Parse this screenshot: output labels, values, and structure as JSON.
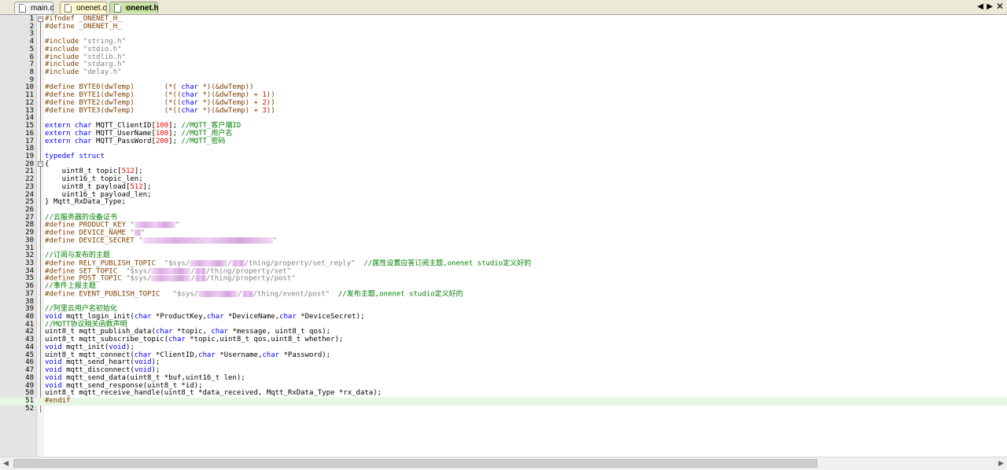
{
  "tabs": [
    {
      "label": "main.c",
      "active": false
    },
    {
      "label": "onenet.c",
      "active": false
    },
    {
      "label": "onenet.h",
      "active": true
    }
  ],
  "icons": {
    "close": "close-icon",
    "tab_left": "scroll-left-icon",
    "tab_right": "scroll-right-icon",
    "file": "file-icon",
    "fold": "fold-marker-icon"
  },
  "colors": {
    "preprocessor": "#804000",
    "string": "#808080",
    "keyword": "#0000ff",
    "number": "#ff0000",
    "comment": "#008000",
    "current_line": "#e8f6e6"
  },
  "editor": {
    "current_line": 51,
    "lines": [
      [
        {
          "t": "#ifndef _ONENET_H_",
          "c": "pp"
        }
      ],
      [
        {
          "t": "#define _ONENET_H_",
          "c": "pp"
        }
      ],
      [],
      [
        {
          "t": "#include ",
          "c": "pp"
        },
        {
          "t": "\"string.h\"",
          "c": "str"
        }
      ],
      [
        {
          "t": "#include ",
          "c": "pp"
        },
        {
          "t": "\"stdio.h\"",
          "c": "str"
        }
      ],
      [
        {
          "t": "#include ",
          "c": "pp"
        },
        {
          "t": "\"stdlib.h\"",
          "c": "str"
        }
      ],
      [
        {
          "t": "#include ",
          "c": "pp"
        },
        {
          "t": "\"stdarg.h\"",
          "c": "str"
        }
      ],
      [
        {
          "t": "#include ",
          "c": "pp"
        },
        {
          "t": "\"delay.h\"",
          "c": "str"
        }
      ],
      [],
      [
        {
          "t": "#define BYTE0(dwTemp)       (*( ",
          "c": "pp"
        },
        {
          "t": "char",
          "c": "kw"
        },
        {
          "t": " *)(&dwTemp))",
          "c": "pp"
        }
      ],
      [
        {
          "t": "#define BYTE1(dwTemp)       (*((",
          "c": "pp"
        },
        {
          "t": "char",
          "c": "kw"
        },
        {
          "t": " *)(&dwTemp) + ",
          "c": "pp"
        },
        {
          "t": "1",
          "c": "num"
        },
        {
          "t": "))",
          "c": "pp"
        }
      ],
      [
        {
          "t": "#define BYTE2(dwTemp)       (*((",
          "c": "pp"
        },
        {
          "t": "char",
          "c": "kw"
        },
        {
          "t": " *)(&dwTemp) + ",
          "c": "pp"
        },
        {
          "t": "2",
          "c": "num"
        },
        {
          "t": "))",
          "c": "pp"
        }
      ],
      [
        {
          "t": "#define BYTE3(dwTemp)       (*((",
          "c": "pp"
        },
        {
          "t": "char",
          "c": "kw"
        },
        {
          "t": " *)(&dwTemp) + ",
          "c": "pp"
        },
        {
          "t": "3",
          "c": "num"
        },
        {
          "t": "))",
          "c": "pp"
        }
      ],
      [],
      [
        {
          "t": "extern char",
          "c": "kw"
        },
        {
          "t": " MQTT_ClientID[",
          "c": ""
        },
        {
          "t": "100",
          "c": "num"
        },
        {
          "t": "]; ",
          "c": ""
        },
        {
          "t": "//MQTT_客户端ID",
          "c": "cm"
        }
      ],
      [
        {
          "t": "extern char",
          "c": "kw"
        },
        {
          "t": " MQTT_UserName[",
          "c": ""
        },
        {
          "t": "100",
          "c": "num"
        },
        {
          "t": "]; ",
          "c": ""
        },
        {
          "t": "//MQTT_用户名",
          "c": "cm"
        }
      ],
      [
        {
          "t": "extern char",
          "c": "kw"
        },
        {
          "t": " MQTT_PassWord[",
          "c": ""
        },
        {
          "t": "200",
          "c": "num"
        },
        {
          "t": "]; ",
          "c": ""
        },
        {
          "t": "//MQTT_密码",
          "c": "cm"
        }
      ],
      [],
      [
        {
          "t": "typedef struct",
          "c": "kw"
        }
      ],
      [
        {
          "t": "{",
          "c": ""
        }
      ],
      [
        {
          "t": "    uint8_t topic[",
          "c": ""
        },
        {
          "t": "512",
          "c": "num"
        },
        {
          "t": "];",
          "c": ""
        }
      ],
      [
        {
          "t": "    uint16_t topic_len;",
          "c": ""
        }
      ],
      [
        {
          "t": "    uint8_t payload[",
          "c": ""
        },
        {
          "t": "512",
          "c": "num"
        },
        {
          "t": "];",
          "c": ""
        }
      ],
      [
        {
          "t": "    uint16_t payload_len;",
          "c": ""
        }
      ],
      [
        {
          "t": "} Mqtt_RxData_Type;",
          "c": ""
        }
      ],
      [],
      [
        {
          "t": "//云服务器的设备证书",
          "c": "cm"
        }
      ],
      [
        {
          "t": "#define PRODUCT_KEY ",
          "c": "pp"
        },
        {
          "t": "\"",
          "c": "str"
        },
        {
          "t": "",
          "c": "blur",
          "w": 52
        },
        {
          "t": "\"",
          "c": "str"
        }
      ],
      [
        {
          "t": "#define DEVICE_NAME ",
          "c": "pp"
        },
        {
          "t": "\"",
          "c": "str"
        },
        {
          "t": "",
          "c": "blur",
          "w": 8
        },
        {
          "t": "\"",
          "c": "str"
        }
      ],
      [
        {
          "t": "#define DEVICE_SECRET ",
          "c": "pp"
        },
        {
          "t": "\"",
          "c": "str"
        },
        {
          "t": "",
          "c": "blur",
          "w": 165
        },
        {
          "t": "\"",
          "c": "str"
        }
      ],
      [],
      [
        {
          "t": "//订阅与发布的主题",
          "c": "cm"
        }
      ],
      [
        {
          "t": "#define RELY_PUBLISH_TOPIC  ",
          "c": "pp"
        },
        {
          "t": "\"$sys/",
          "c": "str"
        },
        {
          "t": "",
          "c": "blur",
          "w": 48
        },
        {
          "t": "/",
          "c": "str"
        },
        {
          "t": "",
          "c": "blur",
          "w": 16
        },
        {
          "t": "/thing/property/set_reply\"",
          "c": "str"
        },
        {
          "t": "  //属性设置应答订阅主题,onenet studio定义好的",
          "c": "cm"
        }
      ],
      [
        {
          "t": "#define SET_TOPIC  ",
          "c": "pp"
        },
        {
          "t": "\"$sys/",
          "c": "str"
        },
        {
          "t": "",
          "c": "blur",
          "w": 50
        },
        {
          "t": "/",
          "c": "str"
        },
        {
          "t": "",
          "c": "blur",
          "w": 14
        },
        {
          "t": "/thing/property/set\"",
          "c": "str"
        }
      ],
      [
        {
          "t": "#define POST_TOPIC ",
          "c": "pp"
        },
        {
          "t": "\"$sys/",
          "c": "str"
        },
        {
          "t": "",
          "c": "blur",
          "w": 50
        },
        {
          "t": "/",
          "c": "str"
        },
        {
          "t": "",
          "c": "blur",
          "w": 14
        },
        {
          "t": "/thing/property/post\"",
          "c": "str"
        }
      ],
      [
        {
          "t": "//事件上报主题",
          "c": "cm"
        }
      ],
      [
        {
          "t": "#define EVENT_PUBLISH_TOPIC   ",
          "c": "pp"
        },
        {
          "t": "\"$sys/",
          "c": "str"
        },
        {
          "t": "",
          "c": "blur",
          "w": 50
        },
        {
          "t": "/",
          "c": "str"
        },
        {
          "t": "",
          "c": "blur",
          "w": 14
        },
        {
          "t": "/thing/event/post\"",
          "c": "str"
        },
        {
          "t": "  //发布主题,onenet studio定义好的",
          "c": "cm"
        }
      ],
      [],
      [
        {
          "t": "//阿里云用户名初始化",
          "c": "cm"
        }
      ],
      [
        {
          "t": "void",
          "c": "kw"
        },
        {
          "t": " mqtt_login_init(",
          "c": ""
        },
        {
          "t": "char",
          "c": "kw"
        },
        {
          "t": " *ProductKey,",
          "c": ""
        },
        {
          "t": "char",
          "c": "kw"
        },
        {
          "t": " *DeviceName,",
          "c": ""
        },
        {
          "t": "char",
          "c": "kw"
        },
        {
          "t": " *DeviceSecret);",
          "c": ""
        }
      ],
      [
        {
          "t": "//MQTT协议相关函数声明",
          "c": "cm"
        }
      ],
      [
        {
          "t": "uint8_t mqtt_publish_data(",
          "c": ""
        },
        {
          "t": "char",
          "c": "kw"
        },
        {
          "t": " *topic, ",
          "c": ""
        },
        {
          "t": "char",
          "c": "kw"
        },
        {
          "t": " *message, uint8_t qos);",
          "c": ""
        }
      ],
      [
        {
          "t": "uint8_t mqtt_subscribe_topic(",
          "c": ""
        },
        {
          "t": "char",
          "c": "kw"
        },
        {
          "t": " *topic,uint8_t qos,uint8_t whether);",
          "c": ""
        }
      ],
      [
        {
          "t": "void",
          "c": "kw"
        },
        {
          "t": " mqtt_init(",
          "c": ""
        },
        {
          "t": "void",
          "c": "kw"
        },
        {
          "t": ");",
          "c": ""
        }
      ],
      [
        {
          "t": "uint8_t mqtt_connect(",
          "c": ""
        },
        {
          "t": "char",
          "c": "kw"
        },
        {
          "t": " *ClientID,",
          "c": ""
        },
        {
          "t": "char",
          "c": "kw"
        },
        {
          "t": " *Username,",
          "c": ""
        },
        {
          "t": "char",
          "c": "kw"
        },
        {
          "t": " *Password);",
          "c": ""
        }
      ],
      [
        {
          "t": "void",
          "c": "kw"
        },
        {
          "t": " mqtt_send_heart(",
          "c": ""
        },
        {
          "t": "void",
          "c": "kw"
        },
        {
          "t": ");",
          "c": ""
        }
      ],
      [
        {
          "t": "void",
          "c": "kw"
        },
        {
          "t": " mqtt_disconnect(",
          "c": ""
        },
        {
          "t": "void",
          "c": "kw"
        },
        {
          "t": ");",
          "c": ""
        }
      ],
      [
        {
          "t": "void",
          "c": "kw"
        },
        {
          "t": " mqtt_send_data(uint8_t *buf,uint16_t len);",
          "c": ""
        }
      ],
      [
        {
          "t": "void",
          "c": "kw"
        },
        {
          "t": " mqtt_send_response(uint8_t *id);",
          "c": ""
        }
      ],
      [
        {
          "t": "uint8_t mqtt_receive_handle(uint8_t *data_received, Mqtt_RxData_Type *rx_data);",
          "c": ""
        }
      ],
      [
        {
          "t": "#endif",
          "c": "pp"
        }
      ],
      []
    ]
  }
}
